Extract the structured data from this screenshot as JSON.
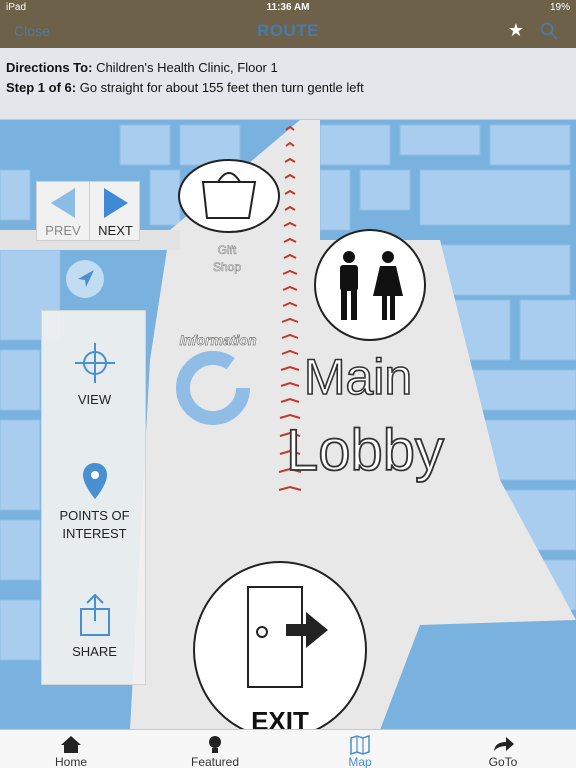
{
  "status": {
    "device": "iPad",
    "time": "11:36 AM",
    "battery": "19%"
  },
  "nav": {
    "close_label": "Close",
    "title": "ROUTE",
    "star_icon": "star-icon",
    "search_icon": "search-icon"
  },
  "directions": {
    "to_label": "Directions To:",
    "to_value": "Children's Health Clinic, Floor 1",
    "step_label": "Step 1 of 6:",
    "step_value": "Go straight for about 155 feet then turn gentle left"
  },
  "prevnext": {
    "prev_label": "PREV",
    "next_label": "NEXT"
  },
  "map_labels": {
    "gift_line1": "Gift",
    "gift_line2": "Shop",
    "information": "Information",
    "main": "Main",
    "lobby": "Lobby",
    "exit": "EXIT"
  },
  "side_panel": {
    "view_label": "VIEW",
    "poi_line1": "POINTS OF",
    "poi_line2": "INTEREST",
    "share_label": "SHARE"
  },
  "tabs": [
    {
      "label": "Home",
      "icon": "home-icon",
      "active": false
    },
    {
      "label": "Featured",
      "icon": "lightbulb-icon",
      "active": false
    },
    {
      "label": "Map",
      "icon": "map-icon",
      "active": true
    },
    {
      "label": "GoTo",
      "icon": "arrow-forward-icon",
      "active": false
    }
  ],
  "colors": {
    "bar": "#6e6149",
    "accent": "#4a8fd0",
    "route": "#c0392b"
  }
}
